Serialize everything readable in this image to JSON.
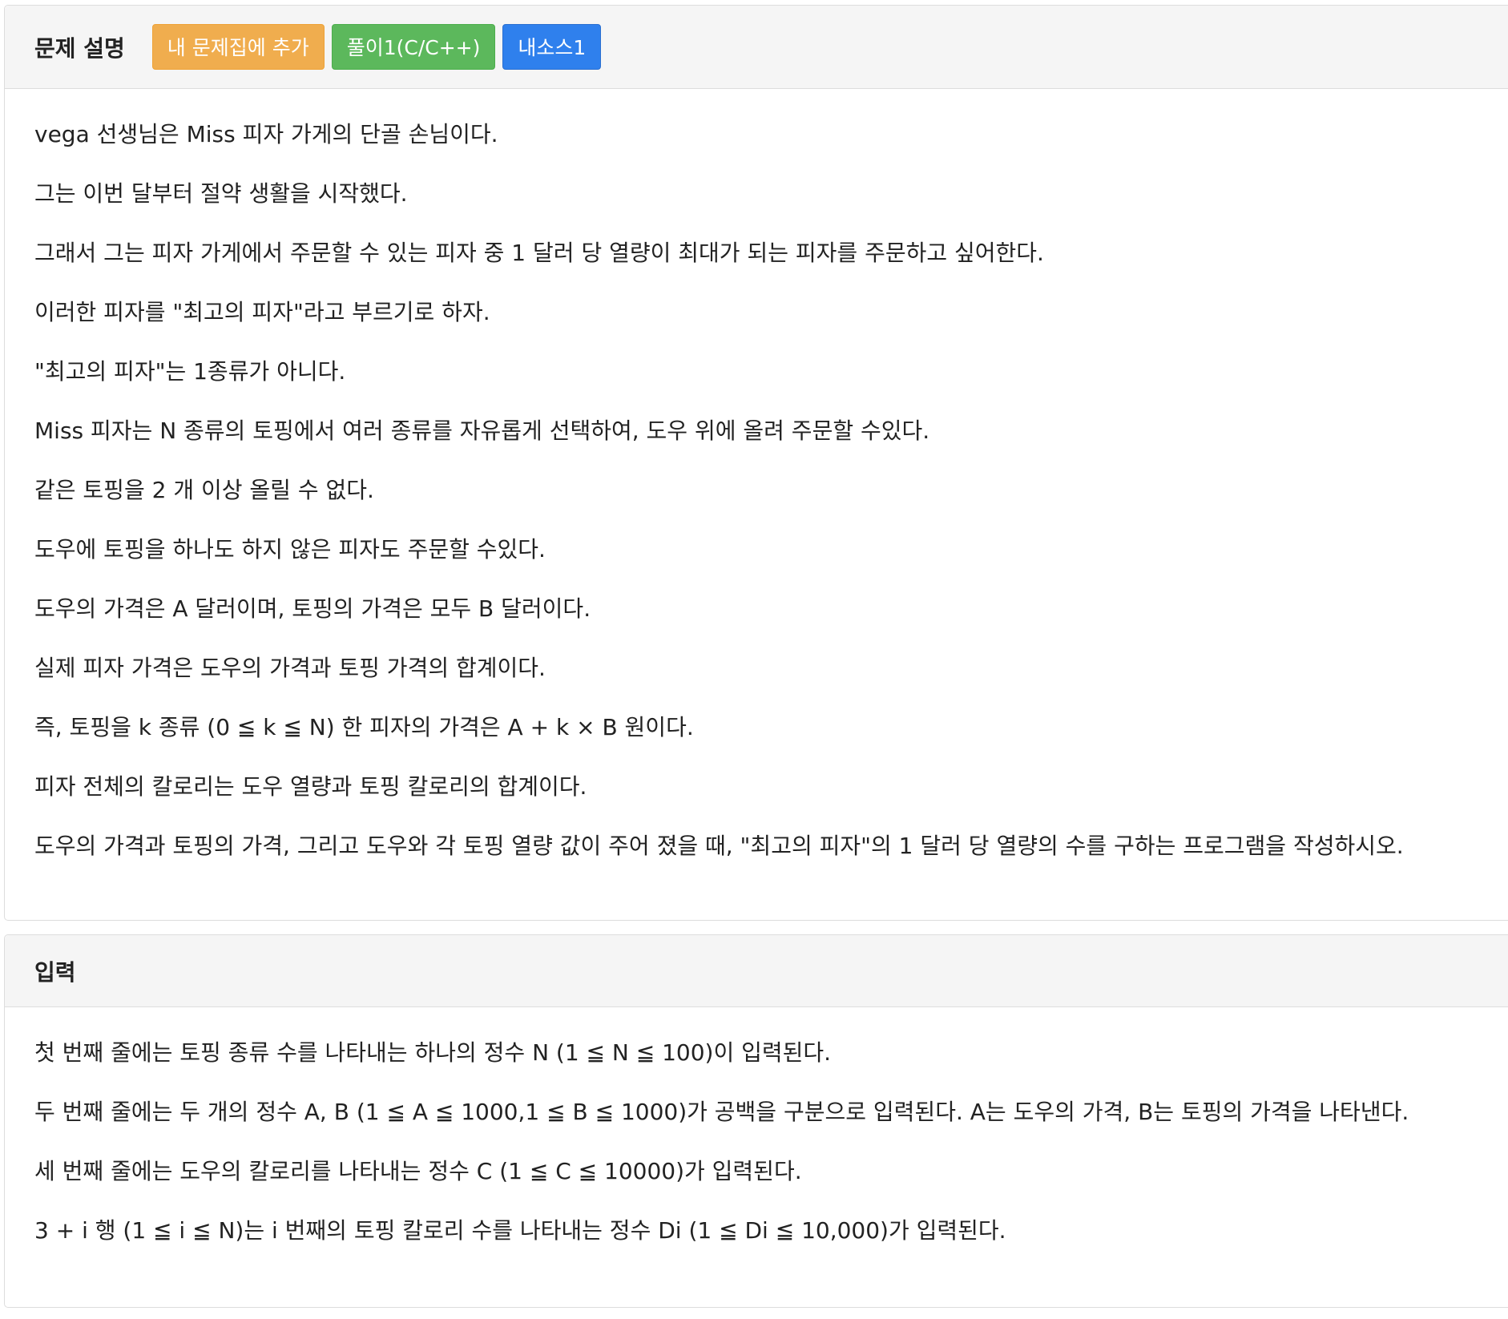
{
  "description": {
    "title": "문제 설명",
    "buttons": {
      "add_to_set": "내 문제집에 추가",
      "solution": "풀이1(C/C++)",
      "my_source": "내소스1"
    },
    "paragraphs": [
      "vega 선생님은 Miss 피자 가게의 단골 손님이다.",
      "그는 이번 달부터 절약 생활을 시작했다.",
      "그래서 그는 피자 가게에서 주문할 수 있는 피자 중 1 달러 당 열량이 최대가 되는 피자를 주문하고 싶어한다.",
      "이러한 피자를 \"최고의 피자\"라고 부르기로 하자.",
      "\"최고의 피자\"는 1종류가 아니다.",
      "Miss 피자는 N 종류의 토핑에서 여러 종류를 자유롭게 선택하여, 도우 위에 올려 주문할 수있다.",
      "같은 토핑을 2 개 이상 올릴 수 없다.",
      "도우에 토핑을 하나도 하지 않은  피자도 주문할 수있다.",
      "도우의 가격은 A 달러이며, 토핑의 가격은 모두 B 달러이다.",
      "실제 피자 가격은 도우의 가격과 토핑 가격의 합계이다.",
      "즉, 토핑을 k 종류 (0 ≦ k ≦ N) 한 피자의 가격은 A + k × B 원이다.",
      "피자 전체의 칼로리는 도우 열량과 토핑 칼로리의 합계이다.",
      "도우의 가격과 토핑의 가격, 그리고 도우와 각 토핑 열량 값이 주어 졌을 때, \"최고의 피자\"의 1 달러 당 열량의 수를 구하는 프로그램을 작성하시오."
    ]
  },
  "input": {
    "title": "입력",
    "paragraphs": [
      "첫 번째 줄에는 토핑 종류 수를 나타내는 하나의 정수 N (1 ≦ N ≦ 100)이 입력된다.",
      "두 번째 줄에는 두 개의 정수 A, B (1 ≦ A ≦ 1000,1 ≦ B ≦ 1000)가 공백을 구분으로 입력된다. A는 도우의 가격, B는 토핑의 가격을 나타낸다.",
      "세 번째 줄에는 도우의 칼로리를 나타내는 정수 C (1 ≦ C ≦ 10000)가 입력된다.",
      "3 + i 행 (1 ≦ i ≦ N)는 i 번째의 토핑 칼로리 수를 나타내는 정수 Di (1 ≦ Di ≦ 10,000)가 입력된다."
    ]
  },
  "colors": {
    "warning": "#f0ad4e",
    "success": "#5cb85c",
    "primary": "#2f80ed",
    "heading_bg": "#f5f5f5"
  }
}
